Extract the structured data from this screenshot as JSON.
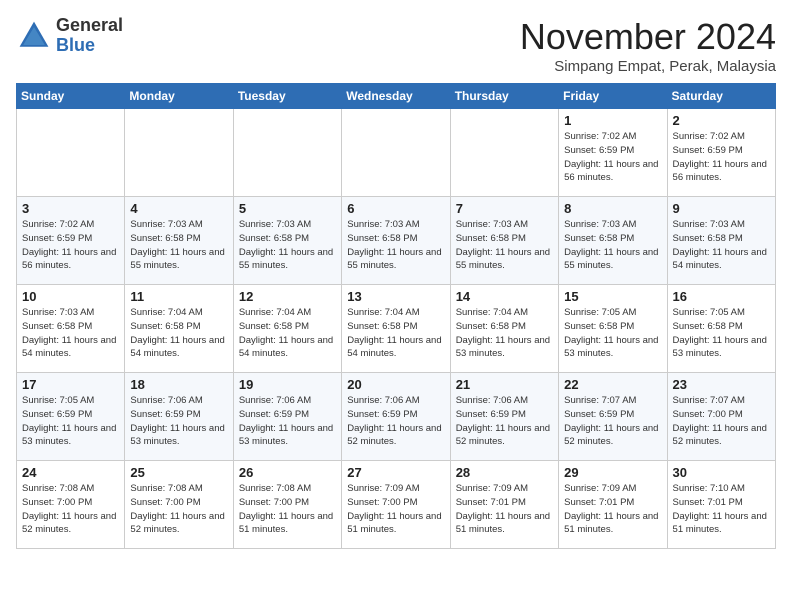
{
  "header": {
    "logo_general": "General",
    "logo_blue": "Blue",
    "month": "November 2024",
    "location": "Simpang Empat, Perak, Malaysia"
  },
  "days_of_week": [
    "Sunday",
    "Monday",
    "Tuesday",
    "Wednesday",
    "Thursday",
    "Friday",
    "Saturday"
  ],
  "weeks": [
    [
      {
        "day": "",
        "info": ""
      },
      {
        "day": "",
        "info": ""
      },
      {
        "day": "",
        "info": ""
      },
      {
        "day": "",
        "info": ""
      },
      {
        "day": "",
        "info": ""
      },
      {
        "day": "1",
        "info": "Sunrise: 7:02 AM\nSunset: 6:59 PM\nDaylight: 11 hours and 56 minutes."
      },
      {
        "day": "2",
        "info": "Sunrise: 7:02 AM\nSunset: 6:59 PM\nDaylight: 11 hours and 56 minutes."
      }
    ],
    [
      {
        "day": "3",
        "info": "Sunrise: 7:02 AM\nSunset: 6:59 PM\nDaylight: 11 hours and 56 minutes."
      },
      {
        "day": "4",
        "info": "Sunrise: 7:03 AM\nSunset: 6:58 PM\nDaylight: 11 hours and 55 minutes."
      },
      {
        "day": "5",
        "info": "Sunrise: 7:03 AM\nSunset: 6:58 PM\nDaylight: 11 hours and 55 minutes."
      },
      {
        "day": "6",
        "info": "Sunrise: 7:03 AM\nSunset: 6:58 PM\nDaylight: 11 hours and 55 minutes."
      },
      {
        "day": "7",
        "info": "Sunrise: 7:03 AM\nSunset: 6:58 PM\nDaylight: 11 hours and 55 minutes."
      },
      {
        "day": "8",
        "info": "Sunrise: 7:03 AM\nSunset: 6:58 PM\nDaylight: 11 hours and 55 minutes."
      },
      {
        "day": "9",
        "info": "Sunrise: 7:03 AM\nSunset: 6:58 PM\nDaylight: 11 hours and 54 minutes."
      }
    ],
    [
      {
        "day": "10",
        "info": "Sunrise: 7:03 AM\nSunset: 6:58 PM\nDaylight: 11 hours and 54 minutes."
      },
      {
        "day": "11",
        "info": "Sunrise: 7:04 AM\nSunset: 6:58 PM\nDaylight: 11 hours and 54 minutes."
      },
      {
        "day": "12",
        "info": "Sunrise: 7:04 AM\nSunset: 6:58 PM\nDaylight: 11 hours and 54 minutes."
      },
      {
        "day": "13",
        "info": "Sunrise: 7:04 AM\nSunset: 6:58 PM\nDaylight: 11 hours and 54 minutes."
      },
      {
        "day": "14",
        "info": "Sunrise: 7:04 AM\nSunset: 6:58 PM\nDaylight: 11 hours and 53 minutes."
      },
      {
        "day": "15",
        "info": "Sunrise: 7:05 AM\nSunset: 6:58 PM\nDaylight: 11 hours and 53 minutes."
      },
      {
        "day": "16",
        "info": "Sunrise: 7:05 AM\nSunset: 6:58 PM\nDaylight: 11 hours and 53 minutes."
      }
    ],
    [
      {
        "day": "17",
        "info": "Sunrise: 7:05 AM\nSunset: 6:59 PM\nDaylight: 11 hours and 53 minutes."
      },
      {
        "day": "18",
        "info": "Sunrise: 7:06 AM\nSunset: 6:59 PM\nDaylight: 11 hours and 53 minutes."
      },
      {
        "day": "19",
        "info": "Sunrise: 7:06 AM\nSunset: 6:59 PM\nDaylight: 11 hours and 53 minutes."
      },
      {
        "day": "20",
        "info": "Sunrise: 7:06 AM\nSunset: 6:59 PM\nDaylight: 11 hours and 52 minutes."
      },
      {
        "day": "21",
        "info": "Sunrise: 7:06 AM\nSunset: 6:59 PM\nDaylight: 11 hours and 52 minutes."
      },
      {
        "day": "22",
        "info": "Sunrise: 7:07 AM\nSunset: 6:59 PM\nDaylight: 11 hours and 52 minutes."
      },
      {
        "day": "23",
        "info": "Sunrise: 7:07 AM\nSunset: 7:00 PM\nDaylight: 11 hours and 52 minutes."
      }
    ],
    [
      {
        "day": "24",
        "info": "Sunrise: 7:08 AM\nSunset: 7:00 PM\nDaylight: 11 hours and 52 minutes."
      },
      {
        "day": "25",
        "info": "Sunrise: 7:08 AM\nSunset: 7:00 PM\nDaylight: 11 hours and 52 minutes."
      },
      {
        "day": "26",
        "info": "Sunrise: 7:08 AM\nSunset: 7:00 PM\nDaylight: 11 hours and 51 minutes."
      },
      {
        "day": "27",
        "info": "Sunrise: 7:09 AM\nSunset: 7:00 PM\nDaylight: 11 hours and 51 minutes."
      },
      {
        "day": "28",
        "info": "Sunrise: 7:09 AM\nSunset: 7:01 PM\nDaylight: 11 hours and 51 minutes."
      },
      {
        "day": "29",
        "info": "Sunrise: 7:09 AM\nSunset: 7:01 PM\nDaylight: 11 hours and 51 minutes."
      },
      {
        "day": "30",
        "info": "Sunrise: 7:10 AM\nSunset: 7:01 PM\nDaylight: 11 hours and 51 minutes."
      }
    ]
  ]
}
